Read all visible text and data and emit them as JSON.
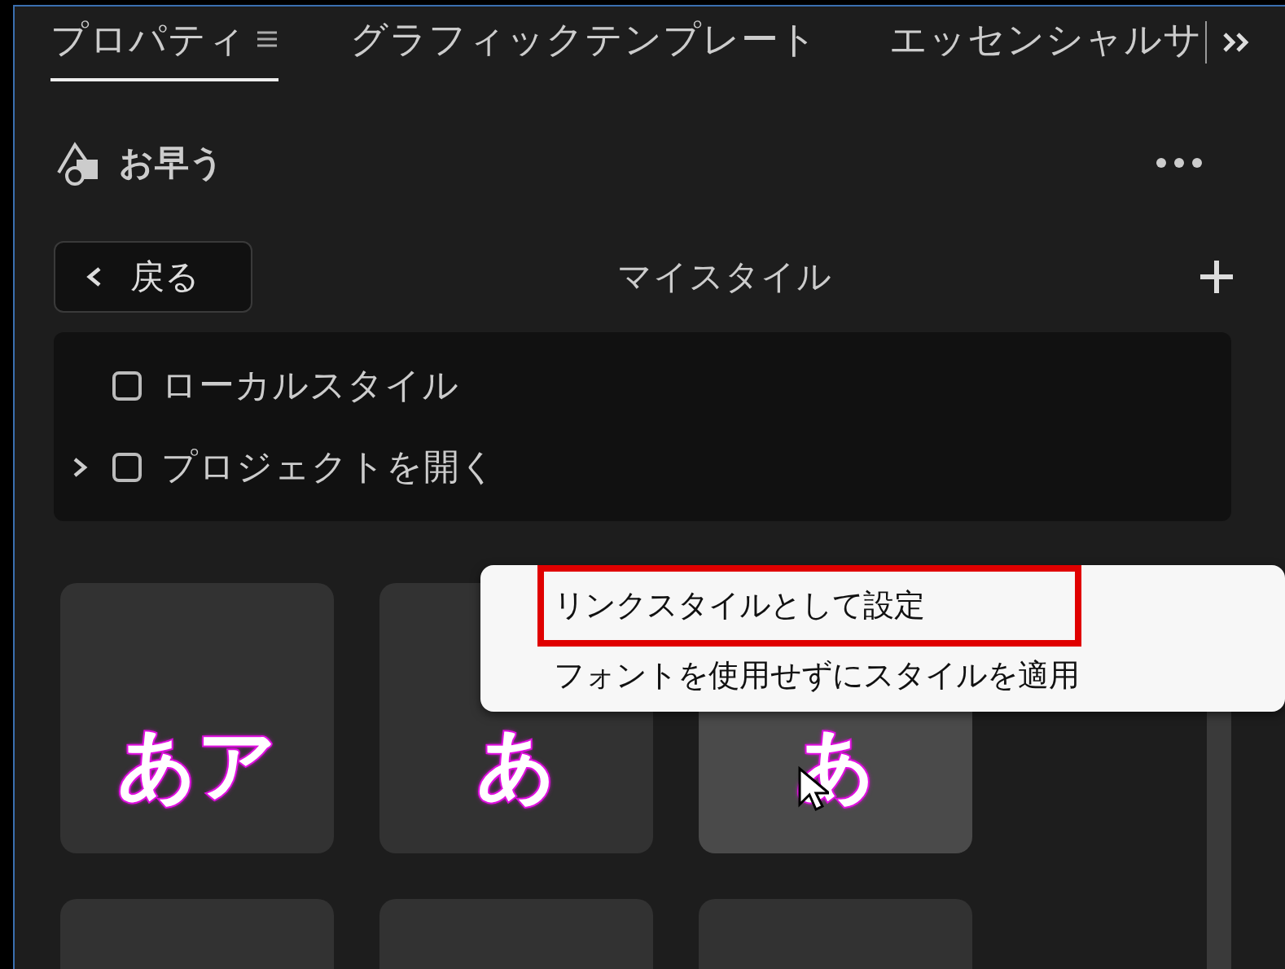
{
  "tabs": [
    {
      "label": "プロパティ",
      "selected": true,
      "menu_icon": true
    },
    {
      "label": "グラフィックテンプレート",
      "selected": false,
      "menu_icon": false
    },
    {
      "label": "エッセンシャルサ",
      "selected": false,
      "menu_icon": false
    }
  ],
  "layer": {
    "name": "お早う"
  },
  "nav": {
    "back": "戻る",
    "title": "マイスタイル"
  },
  "tree": [
    {
      "label": "ローカルスタイル",
      "checked": false,
      "has_children": false
    },
    {
      "label": "プロジェクトを開く",
      "checked": false,
      "has_children": true
    }
  ],
  "tiles": [
    {
      "sample": "あア",
      "hovered": false
    },
    {
      "sample": "あ",
      "hovered": false
    },
    {
      "sample": "あ",
      "hovered": true
    },
    {
      "hovered": false
    },
    {
      "hovered": false
    },
    {
      "hovered": false
    }
  ],
  "context_menu": [
    {
      "label": "リンクスタイルとして設定",
      "highlighted": true
    },
    {
      "label": "フォントを使用せずにスタイルを適用",
      "highlighted": false
    }
  ]
}
